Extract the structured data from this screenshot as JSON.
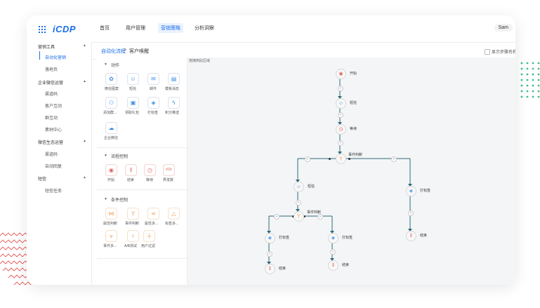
{
  "app": {
    "logo": "iCDP",
    "user": "Sam"
  },
  "nav": [
    "首页",
    "用户管理",
    "营销策略",
    "分析洞察"
  ],
  "sidebar": {
    "groups": [
      {
        "label": "营销工具",
        "items": [
          "自动化营销",
          "落地页"
        ]
      },
      {
        "label": "企业微信运营",
        "items": [
          "渠道码",
          "客户互动",
          "群互动",
          "素材中心"
        ]
      },
      {
        "label": "微信生态运营",
        "items": [
          "渠道码",
          "自动回复"
        ]
      },
      {
        "label": "短信",
        "items": [
          "短信任务"
        ]
      }
    ]
  },
  "breadcrumb": {
    "parent": "自动化流程",
    "sep": ">",
    "current": "客户唤醒"
  },
  "show_step_name": "显示步骤名称",
  "canvas_hint": "拖拽到此区域",
  "palette": {
    "sections": [
      {
        "title": "动作",
        "tools": [
          {
            "label": "微信图案",
            "icon": "wechat-icon"
          },
          {
            "label": "短信",
            "icon": "sms-icon"
          },
          {
            "label": "邮件",
            "icon": "mail-icon"
          },
          {
            "label": "模板消息",
            "icon": "template-icon"
          },
          {
            "label": "添加群...",
            "icon": "add-group-icon"
          },
          {
            "label": "领取礼包",
            "icon": "gift-icon"
          },
          {
            "label": "打标签",
            "icon": "tag-icon"
          },
          {
            "label": "积分推送",
            "icon": "bolt-icon"
          },
          {
            "label": "企业微信",
            "icon": "cloud-icon"
          }
        ]
      },
      {
        "title": "流程控制",
        "tools": [
          {
            "label": "开始",
            "icon": "start-icon"
          },
          {
            "label": "结束",
            "icon": "end-icon"
          },
          {
            "label": "等待",
            "icon": "clock-icon"
          },
          {
            "label": "弄发数",
            "icon": "counter-icon"
          }
        ]
      },
      {
        "title": "条件控制",
        "tools": [
          {
            "label": "属性判断",
            "icon": "split-icon"
          },
          {
            "label": "事件判断",
            "icon": "branch-icon"
          },
          {
            "label": "属性多...",
            "icon": "share-icon"
          },
          {
            "label": "标签多...",
            "icon": "multi-tag-icon"
          },
          {
            "label": "事件多...",
            "icon": "multi-event-icon"
          },
          {
            "label": "A/B测试",
            "icon": "ab-icon"
          },
          {
            "label": "用户过滤",
            "icon": "filter-icon"
          }
        ]
      }
    ]
  },
  "flow": {
    "nodes": [
      {
        "label": "开始",
        "icon": "start-icon",
        "color": "#e0645a"
      },
      {
        "label": "短信",
        "icon": "sms-icon",
        "color": "#3a8ee6"
      },
      {
        "label": "等待",
        "icon": "clock-icon",
        "color": "#e0645a"
      },
      {
        "label": "事件判断",
        "icon": "branch-icon",
        "color": "#f0a050"
      },
      {
        "label": "短信",
        "icon": "sms-icon",
        "color": "#3a8ee6"
      },
      {
        "label": "打标签",
        "icon": "tag-icon",
        "color": "#3a8ee6"
      },
      {
        "label": "事件判断",
        "icon": "branch-icon",
        "color": "#f0a050"
      },
      {
        "label": "结束",
        "icon": "end-icon",
        "color": "#e0645a"
      },
      {
        "label": "打标签",
        "icon": "tag-icon",
        "color": "#3a8ee6"
      },
      {
        "label": "打标签",
        "icon": "tag-icon",
        "color": "#3a8ee6"
      },
      {
        "label": "结束",
        "icon": "end-icon",
        "color": "#e0645a"
      },
      {
        "label": "结束",
        "icon": "end-icon",
        "color": "#e0645a"
      }
    ]
  },
  "colors": {
    "accent": "#1a6ee8",
    "line": "#2b6a78",
    "deco_green": "#3dbf8f",
    "deco_red": "#e85c5c"
  }
}
